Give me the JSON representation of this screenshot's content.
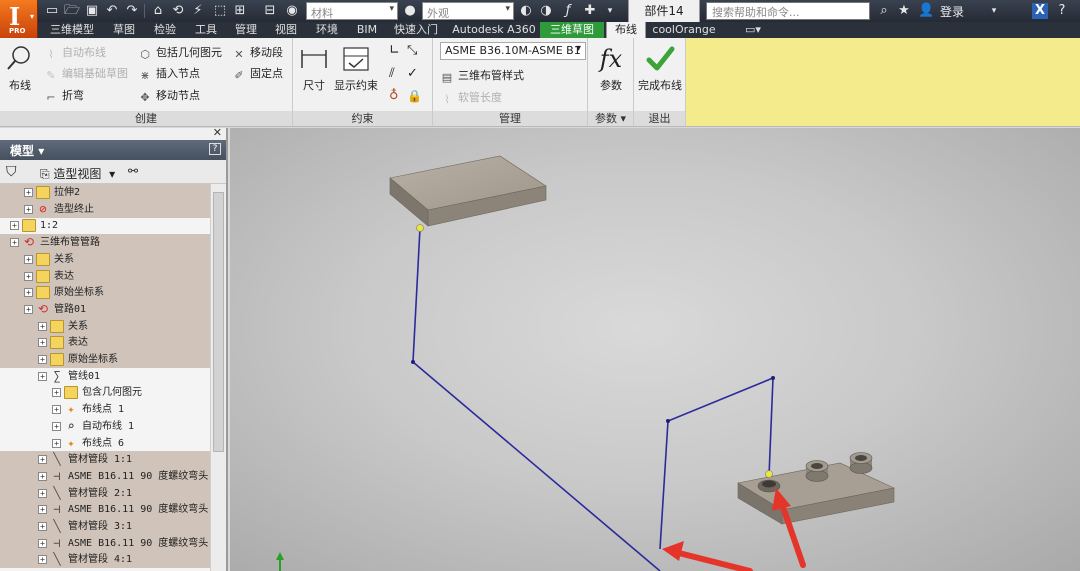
{
  "app": {
    "edition_badge": "PRO",
    "document_tab": "部件14"
  },
  "quick_access": {
    "material_combo": "材料",
    "appearance_combo": "外观",
    "help_search_placeholder": "搜索帮助和命令...",
    "login_label": "登录"
  },
  "ribbon_tabs": [
    "三维模型",
    "草图",
    "检验",
    "工具",
    "管理",
    "视图",
    "环境",
    "BIM",
    "快速入门",
    "Autodesk A360",
    "三维草图",
    "布线",
    "coolOrange"
  ],
  "ribbon": {
    "create": {
      "title": "创建",
      "route_label": "布线",
      "auto_route_label": "自动布线",
      "edit_base_label": "编辑基础草图",
      "bend_label": "折弯",
      "include_geometry_label": "包括几何图元",
      "insert_node_label": "插入节点",
      "move_node_label": "移动节点",
      "move_segment_label": "移动段",
      "fixed_point_label": "固定点"
    },
    "constrain": {
      "title": "约束",
      "dimension_label": "尺寸",
      "show_constraints_label": "显示约束"
    },
    "manage": {
      "title": "管理",
      "style_combo": "ASME B36.10M-ASME B1",
      "style_label": "三维布管样式",
      "pipe_length_label": "软管长度"
    },
    "parameters": {
      "title": "参数",
      "params_label": "参数"
    },
    "exit": {
      "title": "退出",
      "finish_route_label": "完成布线"
    }
  },
  "browser": {
    "title": "模型",
    "view_label": "造型视图",
    "tree": [
      {
        "label": "拉伸2",
        "indent": 2,
        "icon": "extrude-icon",
        "hl": true
      },
      {
        "label": "造型终止",
        "indent": 2,
        "icon": "end-of-part-icon",
        "hl": true
      },
      {
        "label": "1:2",
        "indent": 1,
        "icon": "part-icon",
        "hl": false
      },
      {
        "label": "三维布管管路",
        "indent": 1,
        "icon": "tube-pipe-run-icon",
        "hl": true
      },
      {
        "label": "关系",
        "indent": 2,
        "icon": "folder-icon",
        "hl": true
      },
      {
        "label": "表达",
        "indent": 2,
        "icon": "representations-icon",
        "hl": true
      },
      {
        "label": "原始坐标系",
        "indent": 2,
        "icon": "folder-icon",
        "hl": true
      },
      {
        "label": "管路01",
        "indent": 2,
        "icon": "run-icon",
        "hl": true
      },
      {
        "label": "关系",
        "indent": 3,
        "icon": "folder-icon",
        "hl": true
      },
      {
        "label": "表达",
        "indent": 3,
        "icon": "representations-icon",
        "hl": true
      },
      {
        "label": "原始坐标系",
        "indent": 3,
        "icon": "folder-icon",
        "hl": true
      },
      {
        "label": "管线01",
        "indent": 3,
        "icon": "route-icon",
        "hl": false
      },
      {
        "label": "包含几何图元",
        "indent": 4,
        "icon": "folder-icon",
        "hl": false
      },
      {
        "label": "布线点 1",
        "indent": 4,
        "icon": "route-point-icon",
        "hl": false
      },
      {
        "label": "自动布线 1",
        "indent": 4,
        "icon": "auto-route-icon",
        "hl": false
      },
      {
        "label": "布线点 6",
        "indent": 4,
        "icon": "route-point-icon",
        "hl": false
      },
      {
        "label": "管材管段 1:1",
        "indent": 3,
        "icon": "pipe-segment-icon",
        "hl": true
      },
      {
        "label": "ASME B16.11 90 度螺纹弯头",
        "indent": 3,
        "icon": "elbow-fitting-icon",
        "hl": true
      },
      {
        "label": "管材管段 2:1",
        "indent": 3,
        "icon": "pipe-segment-icon",
        "hl": true
      },
      {
        "label": "ASME B16.11 90 度螺纹弯头",
        "indent": 3,
        "icon": "elbow-fitting-icon",
        "hl": true
      },
      {
        "label": "管材管段 3:1",
        "indent": 3,
        "icon": "pipe-segment-icon",
        "hl": true
      },
      {
        "label": "ASME B16.11 90 度螺纹弯头",
        "indent": 3,
        "icon": "elbow-fitting-icon",
        "hl": true
      },
      {
        "label": "管材管段 4:1",
        "indent": 3,
        "icon": "pipe-segment-icon",
        "hl": true
      }
    ]
  },
  "colors": {
    "route_line": "#2a2a9c",
    "annotation_arrow": "#e5352b",
    "context_tab": "#2e9a3a",
    "ribbon_highlight": "#f4ec8c"
  }
}
